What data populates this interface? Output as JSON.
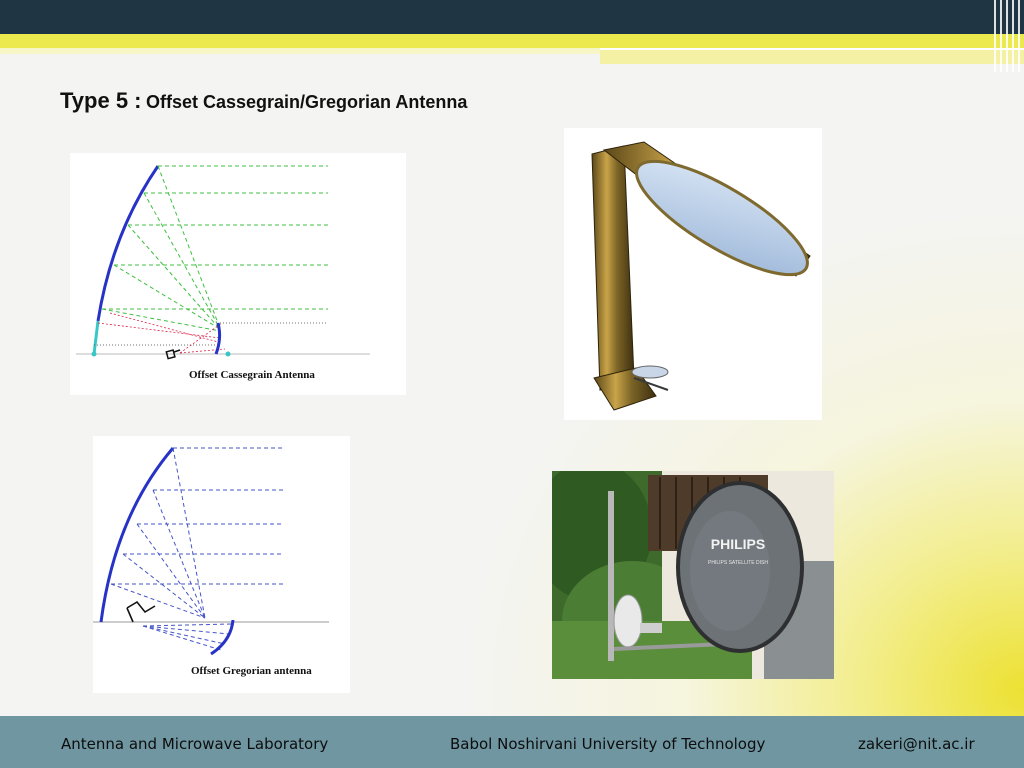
{
  "slide": {
    "title_prefix": "Type 5 :",
    "title_main": "Offset Cassegrain/Gregorian Antenna"
  },
  "figures": {
    "cassegrain_caption": "Offset Cassegrain Antenna",
    "gregorian_caption": "Offset Gregorian antenna",
    "satellite_photo": "satellite-reflector-photo",
    "dish_photo": {
      "brand": "PHILIPS",
      "sub": "PHILIPS SATELLITE DISH"
    }
  },
  "footer": {
    "lab": "Antenna and Microwave Laboratory",
    "university": "Babol Noshirvani University of Technology",
    "email": "zakeri@nit.ac.ir"
  },
  "colors": {
    "topbar": "#203544",
    "accent_yellow": "#ece94f",
    "footer": "#6f96a1"
  }
}
